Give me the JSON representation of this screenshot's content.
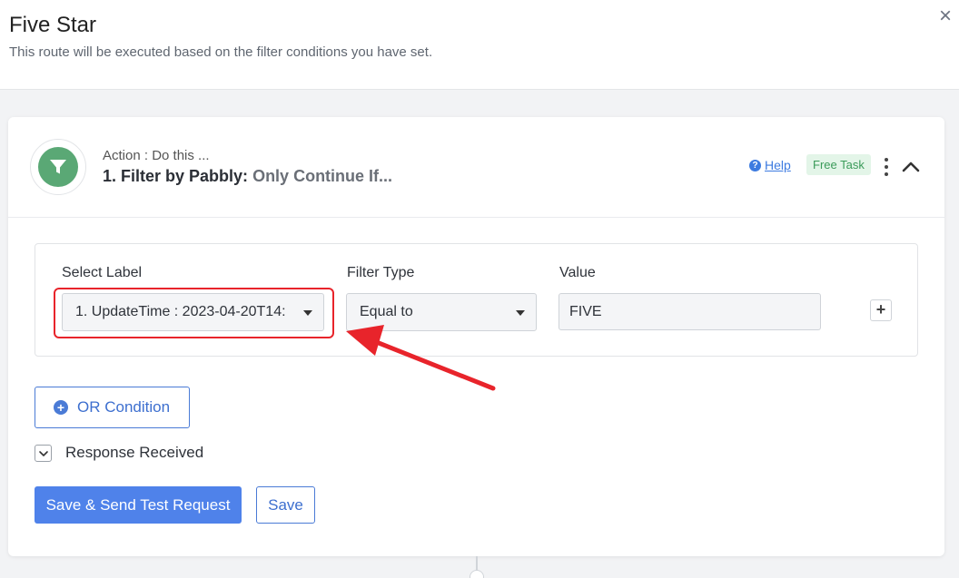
{
  "modal": {
    "title": "Five Star",
    "subtitle": "This route will be executed based on the filter conditions you have set.",
    "close_glyph": "×"
  },
  "step": {
    "kicker": "Action : Do this ...",
    "title": "1. Filter by Pabbly:",
    "subtitle": "Only Continue If...",
    "icon": "filter-icon",
    "icon_color": "#5aa875",
    "help_label": "Help",
    "badge": "Free Task"
  },
  "filter": {
    "select_label": "Select Label",
    "select_value": "1. UpdateTime : 2023-04-20T14:",
    "type_label": "Filter Type",
    "type_value": "Equal to",
    "value_label": "Value",
    "value_value": "FIVE",
    "add_glyph": "+"
  },
  "actions": {
    "or_condition": "OR Condition",
    "response_received": "Response Received",
    "save_send": "Save & Send Test Request",
    "save": "Save"
  },
  "colors": {
    "accent": "#4f82ea",
    "annotation": "#e8242b",
    "badge_bg": "#e3f5e8"
  }
}
